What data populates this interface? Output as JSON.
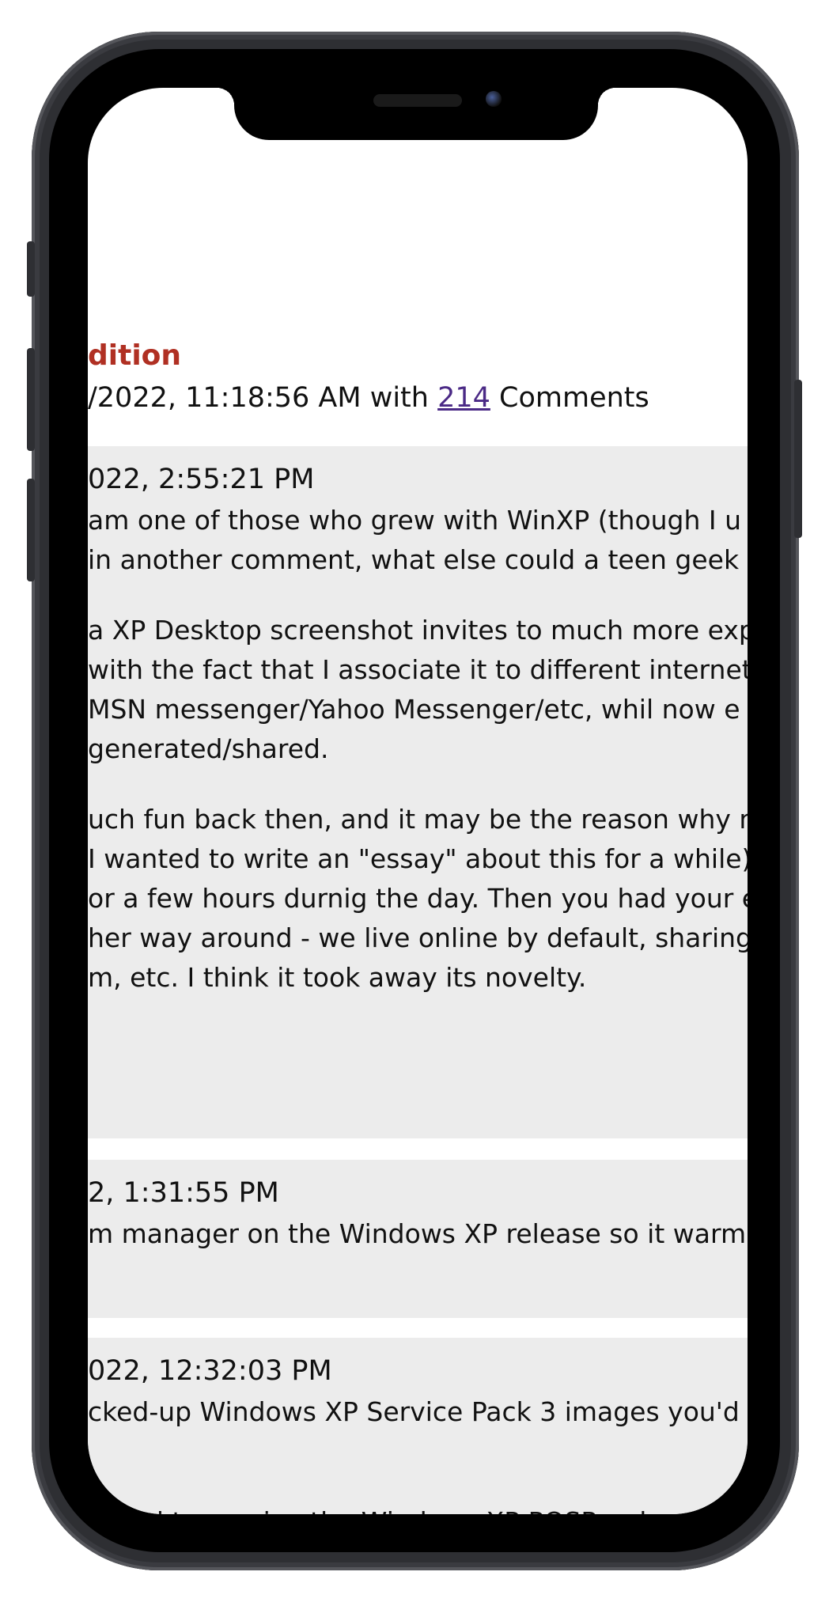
{
  "article": {
    "title_fragment": "dition",
    "meta_prefix": "/2022, 11:18:56 AM with ",
    "comment_count": "214",
    "meta_suffix": " Comments"
  },
  "comments": [
    {
      "date": "022, 2:55:21 PM",
      "lines": [
        "am one of those who grew with WinXP (though I u",
        "in another comment, what else could a teen geek w",
        "a XP Desktop screenshot invites to much more exp",
        "with the fact that I associate it to different internet",
        "MSN messenger/Yahoo Messenger/etc, whil now e",
        "generated/shared.",
        "uch fun back then, and it may be the reason why n",
        "I wanted to write an \"essay\" about this for a while)",
        "or a few hours durnig the day. Then you had your e",
        "her way around - we live online by default, sharing",
        "m, etc. I think it took away its novelty."
      ]
    },
    {
      "date": "2, 1:31:55 PM",
      "lines": [
        "m manager on the Windows XP release so it warm"
      ]
    },
    {
      "date": "022, 12:32:03 PM",
      "lines": [
        "cked-up Windows XP Service Pack 3 images you'd",
        "gured to receive the Windows XP POSReady securi"
      ]
    }
  ]
}
